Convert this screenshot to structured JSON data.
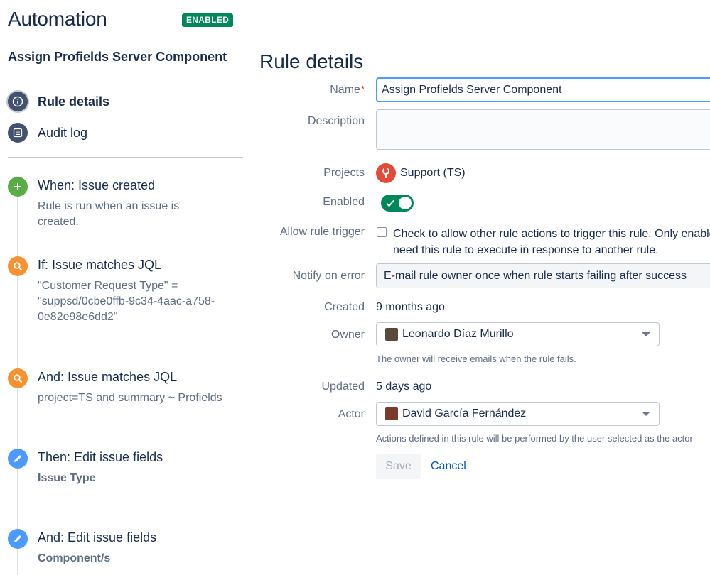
{
  "app": {
    "title": "Automation",
    "status_badge": "ENABLED"
  },
  "sidebar": {
    "rule_name": "Assign Profields Server Component",
    "nav": [
      {
        "label": "Rule details",
        "icon": "info-icon",
        "active": true
      },
      {
        "label": "Audit log",
        "icon": "list-icon",
        "active": false
      }
    ],
    "components": [
      {
        "title": "When: Issue created",
        "description": "Rule is run when an issue is created.",
        "icon": "plus-icon",
        "color": "#5aac44"
      },
      {
        "title": "If: Issue matches JQL",
        "description": "\"Customer Request Type\" = \"suppsd/0cbe0ffb-9c34-4aac-a758-0e82e98e6dd2\"",
        "icon": "search-icon",
        "color": "#f79232"
      },
      {
        "title": "And: Issue matches JQL",
        "description": "project=TS and summary ~ Profields",
        "icon": "search-icon",
        "color": "#f79232"
      },
      {
        "title": "Then: Edit issue fields",
        "description": "Issue Type",
        "icon": "pencil-icon",
        "color": "#4c9aff"
      },
      {
        "title": "And: Edit issue fields",
        "description": "Component/s",
        "icon": "pencil-icon",
        "color": "#4c9aff"
      }
    ]
  },
  "form": {
    "heading": "Rule details",
    "labels": {
      "name": "Name",
      "description": "Description",
      "projects": "Projects",
      "enabled": "Enabled",
      "allow_rule_trigger": "Allow rule trigger",
      "notify_on_error": "Notify on error",
      "created": "Created",
      "owner": "Owner",
      "updated": "Updated",
      "actor": "Actor"
    },
    "name_value": "Assign Profields Server Component",
    "description_value": "",
    "project": "Support (TS)",
    "enabled": true,
    "allow_rule_trigger_text_line1": "Check to allow other rule actions to trigger this rule. Only enable",
    "allow_rule_trigger_text_line2": "need this rule to execute in response to another rule.",
    "allow_rule_trigger_checked": false,
    "notify_on_error_value": "E-mail rule owner once when rule starts failing after success",
    "created_value": "9 months ago",
    "owner_value": "Leonardo Díaz Murillo",
    "owner_help": "The owner will receive emails when the rule fails.",
    "updated_value": "5 days ago",
    "actor_value": "David García Fernández",
    "actor_help": "Actions defined in this rule will be performed by the user selected as the actor",
    "save_label": "Save",
    "cancel_label": "Cancel"
  },
  "colors": {
    "accent": "#0052cc",
    "enabled_green": "#00875a",
    "trigger_green": "#5aac44",
    "condition_orange": "#f79232",
    "action_blue": "#4c9aff",
    "project_red": "#e5493a"
  }
}
